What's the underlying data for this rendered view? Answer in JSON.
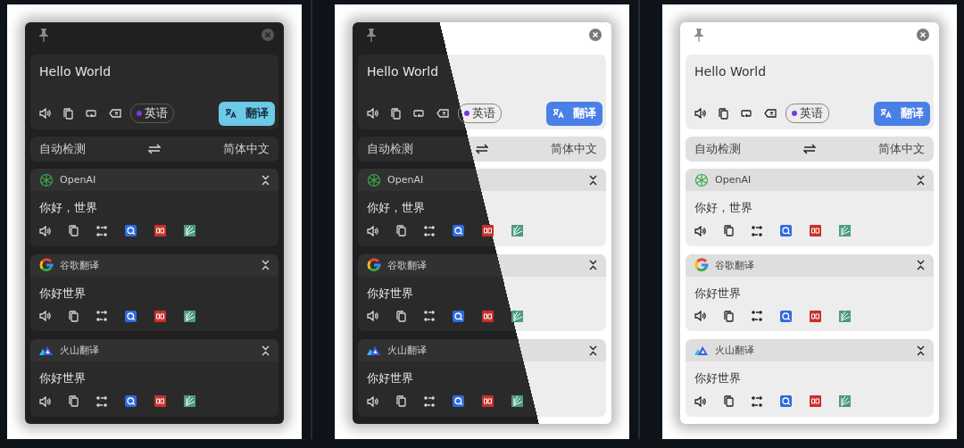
{
  "panels": [
    {
      "kind": "dark",
      "input": {
        "value": "Hello World"
      },
      "language_tag": "英语",
      "translate_button": "翻译",
      "source_language": "自动检测",
      "target_language": "简体中文",
      "results": [
        {
          "kind": "openai",
          "service": "OpenAI",
          "text": "你好，世界"
        },
        {
          "kind": "google",
          "service": "谷歌翻译",
          "text": "你好世界"
        },
        {
          "kind": "volcano",
          "service": "火山翻译",
          "text": "你好世界"
        }
      ]
    },
    {
      "kind": "split",
      "input": {
        "value": "Hello World"
      },
      "language_tag": "英语",
      "translate_button": "翻译",
      "source_language": "自动检测",
      "target_language": "简体中文",
      "results": [
        {
          "kind": "openai",
          "service": "OpenAI",
          "text": "你好，世界"
        },
        {
          "kind": "google",
          "service": "谷歌翻译",
          "text": "你好世界"
        },
        {
          "kind": "volcano",
          "service": "火山翻译",
          "text": "你好世界"
        }
      ]
    },
    {
      "kind": "light",
      "input": {
        "value": "Hello World"
      },
      "language_tag": "英语",
      "translate_button": "翻译",
      "source_language": "自动检测",
      "target_language": "简体中文",
      "results": [
        {
          "kind": "openai",
          "service": "OpenAI",
          "text": "你好，世界"
        },
        {
          "kind": "google",
          "service": "谷歌翻译",
          "text": "你好世界"
        },
        {
          "kind": "volcano",
          "service": "火山翻译",
          "text": "你好世界"
        }
      ]
    }
  ]
}
